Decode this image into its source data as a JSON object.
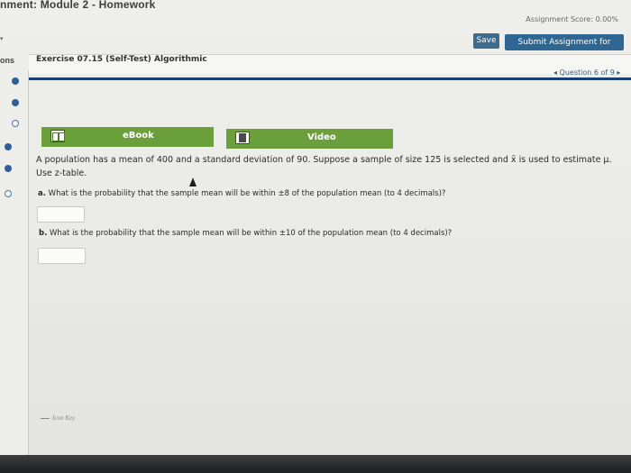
{
  "header": {
    "title": "nment: Module 2 - Homework",
    "score_label": "Assignment Score: 0.00%",
    "save_label": "Save",
    "submit_label": "Submit Assignment for Grading"
  },
  "sidebar": {
    "label": "ons",
    "question_status": [
      "answered",
      "answered",
      "open",
      "answered",
      "answered",
      "open"
    ]
  },
  "exercise": {
    "title": "Exercise 07.15 (Self-Test) Algorithmic",
    "nav": "◂ Question 6 of 9 ▸"
  },
  "resources": {
    "ebook_label": "eBook",
    "video_label": "Video"
  },
  "question": {
    "problem": "A population has a mean of 400 and a standard deviation of 90. Suppose a sample of size 125 is selected and x̄ is used to estimate μ.",
    "ztable": "Use z-table.",
    "part_a_prefix": "a.",
    "part_a": "What is the probability that the sample mean will be within ±8 of the population mean (to 4 decimals)?",
    "part_b_prefix": "b.",
    "part_b": "What is the probability that the sample mean will be within ±10 of the population mean (to 4 decimals)?",
    "answer_a": "",
    "answer_b": ""
  },
  "footer": {
    "icon_key_label": "Icon Key"
  },
  "colors": {
    "accent_blue": "#2f6692",
    "resource_green": "#6a9f3b",
    "rule_navy": "#1a3e6e"
  }
}
